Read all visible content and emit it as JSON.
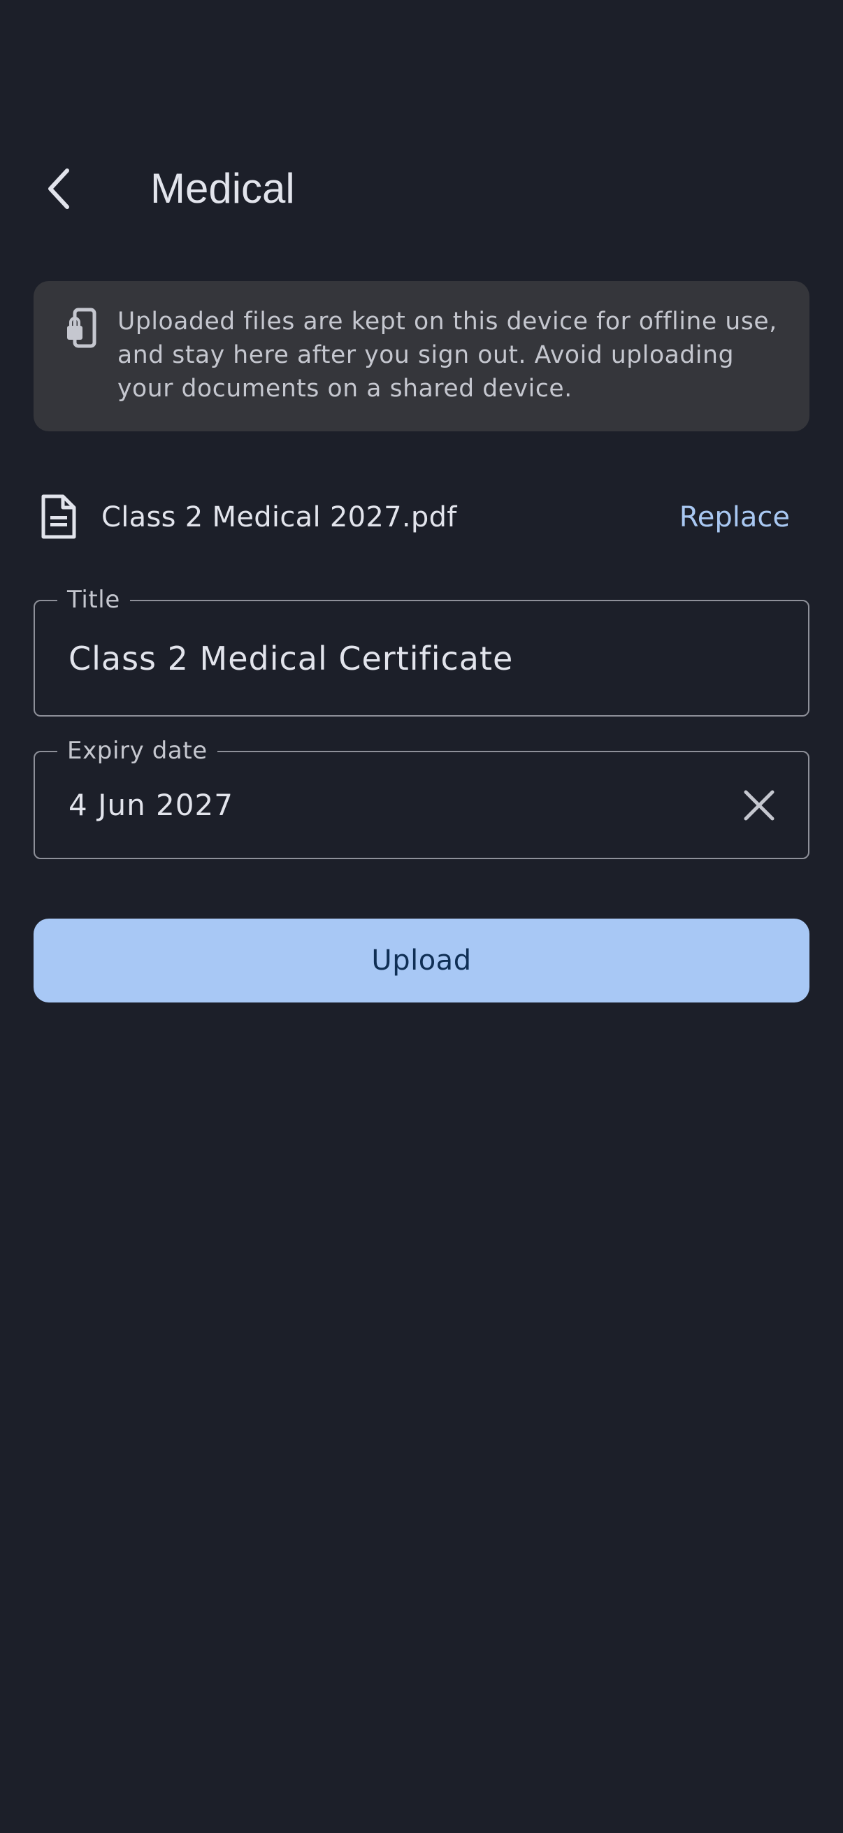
{
  "header": {
    "title": "Medical",
    "back_icon": "chevron-left-icon"
  },
  "notice": {
    "icon": "device-lock-icon",
    "text": "Uploaded files are kept on this device for offline use, and stay here after you sign out. Avoid uploading your documents on a shared device."
  },
  "file": {
    "icon": "document-icon",
    "name": "Class 2 Medical 2027.pdf",
    "replace_label": "Replace"
  },
  "form": {
    "title_label": "Title",
    "title_value": "Class 2 Medical Certificate",
    "expiry_label": "Expiry date",
    "expiry_value": "4 Jun 2027",
    "clear_icon": "close-icon"
  },
  "actions": {
    "upload_label": "Upload"
  },
  "colors": {
    "background": "#1C1F29",
    "surface": "#35363B",
    "accent": "#A8C8F5",
    "accent_text": "#0F2F55",
    "link": "#A9C8F2"
  }
}
